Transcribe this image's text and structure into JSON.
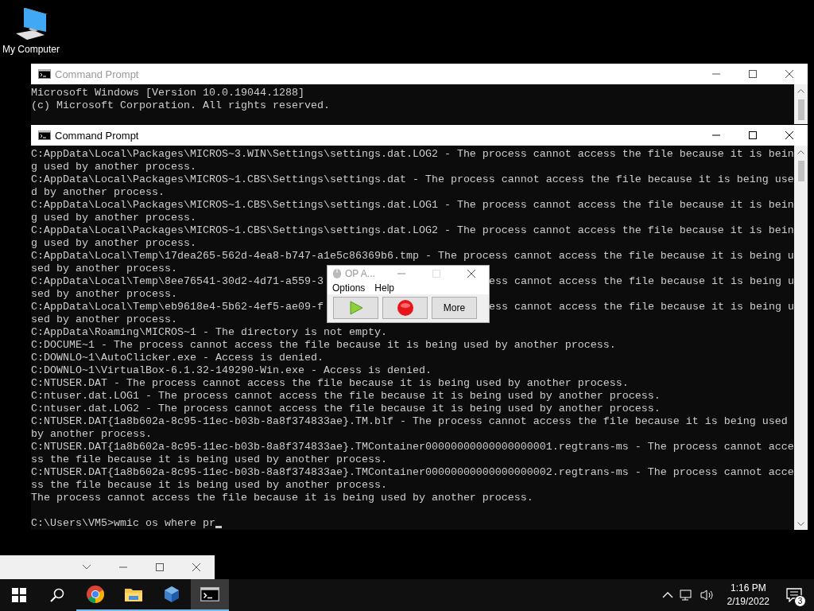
{
  "desktop_icons": [
    {
      "label": "My Computer"
    }
  ],
  "windows": [
    {
      "title": "Command Prompt",
      "active": false,
      "lines": [
        {
          "text": "Microsoft Windows [Version 10.0.19044.1288]"
        },
        {
          "text": "(c) Microsoft Corporation. All rights reserved."
        }
      ]
    },
    {
      "title": "Command Prompt",
      "active": true,
      "lines": [
        {
          "text": "C:AppData\\Local\\Packages\\MICROS~3.WIN\\Settings\\settings.dat.LOG2 - The process cannot access the file because it is bein"
        },
        {
          "text": "g used by another process."
        },
        {
          "text": "C:AppData\\Local\\Packages\\MICROS~1.CBS\\Settings\\settings.dat - The process cannot access the file because it is being use"
        },
        {
          "text": "d by another process."
        },
        {
          "text": "C:AppData\\Local\\Packages\\MICROS~1.CBS\\Settings\\settings.dat.LOG1 - The process cannot access the file because it is bein"
        },
        {
          "text": "g used by another process."
        },
        {
          "text": "C:AppData\\Local\\Packages\\MICROS~1.CBS\\Settings\\settings.dat.LOG2 - The process cannot access the file because it is bein"
        },
        {
          "text": "g used by another process."
        },
        {
          "text": "C:AppData\\Local\\Temp\\17dea265-562d-4ea8-b747-a1e5c86369b6.tmp - The process cannot access the file because it is being u"
        },
        {
          "text": "sed by another process."
        },
        {
          "text": "C:AppData\\Local\\Temp\\8ee76541-30d2-4d71-a559-3",
          "tail": "ess cannot access the file because it is being u"
        },
        {
          "text": "sed by another process."
        },
        {
          "text": "C:AppData\\Local\\Temp\\eb9618e4-5b62-4ef5-ae09-f",
          "tail": "ess cannot access the file because it is being u"
        },
        {
          "text": "sed by another process."
        },
        {
          "text": "C:AppData\\Roaming\\MICROS~1 - The directory is not empty."
        },
        {
          "text": "C:DOCUME~1 - The process cannot access the file because it is being used by another process."
        },
        {
          "text": "C:DOWNLO~1\\AutoClicker.exe - Access is denied."
        },
        {
          "text": "C:DOWNLO~1\\VirtualBox-6.1.32-149290-Win.exe - Access is denied."
        },
        {
          "text": "C:NTUSER.DAT - The process cannot access the file because it is being used by another process."
        },
        {
          "text": "C:ntuser.dat.LOG1 - The process cannot access the file because it is being used by another process."
        },
        {
          "text": "C:ntuser.dat.LOG2 - The process cannot access the file because it is being used by another process."
        },
        {
          "text": "C:NTUSER.DAT{1a8b602a-8c95-11ec-b03b-8a8f374833ae}.TM.blf - The process cannot access the file because it is being used"
        },
        {
          "text": "by another process."
        },
        {
          "text": "C:NTUSER.DAT{1a8b602a-8c95-11ec-b03b-8a8f374833ae}.TMContainer00000000000000000001.regtrans-ms - The process cannot acce"
        },
        {
          "text": "ss the file because it is being used by another process."
        },
        {
          "text": "C:NTUSER.DAT{1a8b602a-8c95-11ec-b03b-8a8f374833ae}.TMContainer00000000000000000002.regtrans-ms - The process cannot acce"
        },
        {
          "text": "ss the file because it is being used by another process."
        },
        {
          "text": "The process cannot access the file because it is being used by another process."
        }
      ],
      "prompt": "C:\\Users\\VM5>wmic os where pr"
    }
  ],
  "popup": {
    "title": "OP A...",
    "menu": [
      "Options",
      "Help"
    ],
    "buttons": [
      {
        "kind": "play"
      },
      {
        "kind": "record"
      },
      {
        "kind": "text",
        "label": "More"
      }
    ]
  },
  "taskbar": {
    "apps": [
      {
        "kind": "start",
        "running": false,
        "selected": false
      },
      {
        "kind": "search",
        "running": false,
        "selected": false
      },
      {
        "kind": "browser",
        "running": true,
        "selected": false
      },
      {
        "kind": "folder",
        "running": true,
        "selected": false
      },
      {
        "kind": "cube",
        "running": true,
        "selected": false
      },
      {
        "kind": "console",
        "running": true,
        "selected": true
      }
    ],
    "time": "1:16 PM",
    "date": "2/19/2022",
    "notification_count": "3"
  }
}
